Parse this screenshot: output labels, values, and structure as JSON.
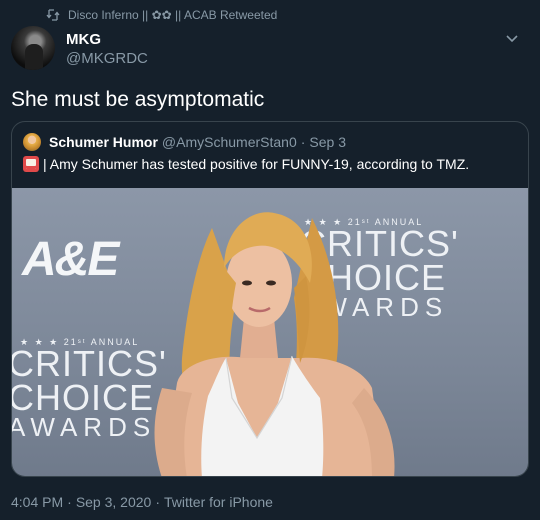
{
  "retweet": {
    "icon": "retweet-icon",
    "text": "Disco Inferno || ✿✿ || ACAB Retweeted"
  },
  "author": {
    "name": "MKG",
    "handle": "@MKGRDC",
    "avatar": "avatar"
  },
  "tweet": {
    "text": "She must be asymptomatic"
  },
  "quote": {
    "name": "Schumer Humor",
    "handle": "@AmySchumerStan0",
    "separator": "·",
    "date": "Sep 3",
    "emoji": "calendar-emoji-icon",
    "body": "| Amy Schumer  has tested positive for FUNNY-19, according to TMZ."
  },
  "photo": {
    "backdrop": {
      "logo": "A&E",
      "annual": "21ˢᵗ ANNUAL",
      "line1": "CRITICS'",
      "line2": "CHOICE",
      "line3": "AWARDS",
      "stars": "★ ★ ★"
    }
  },
  "meta": {
    "time": "4:04 PM",
    "date": "Sep 3, 2020",
    "source": "Twitter for iPhone",
    "separator": "·"
  },
  "colors": {
    "background": "#15202b",
    "secondary_text": "#8899a6",
    "border": "#38444d",
    "backdrop": "#7c8798"
  }
}
